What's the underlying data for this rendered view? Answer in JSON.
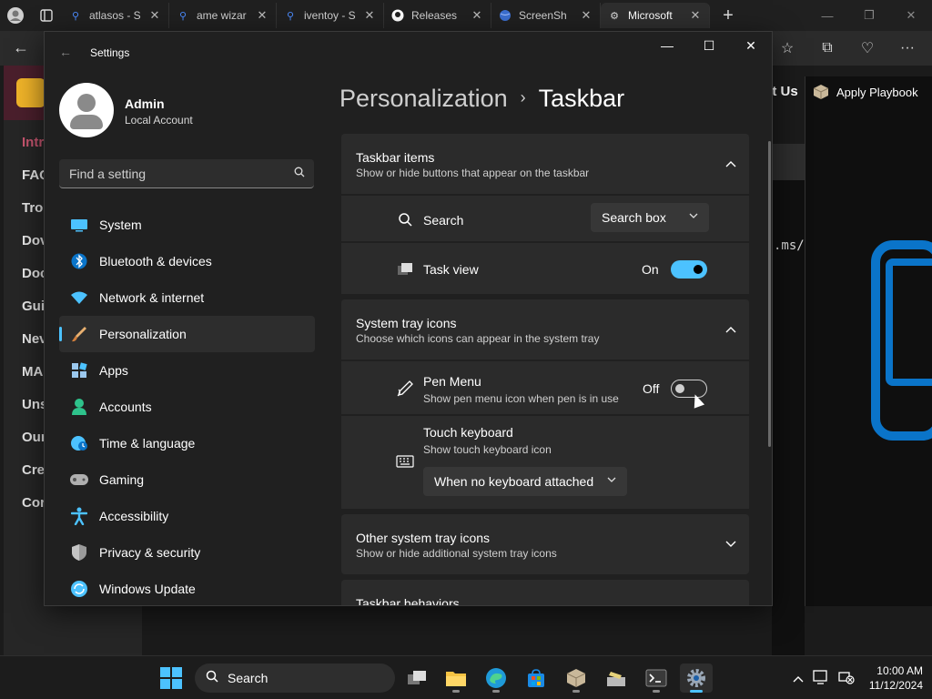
{
  "browser": {
    "tabs": [
      {
        "label": "atlasos - S",
        "icon": "search-icon"
      },
      {
        "label": "ame wizar",
        "icon": "search-icon"
      },
      {
        "label": "iventoy - S",
        "icon": "search-icon"
      },
      {
        "label": "Releases",
        "icon": "github-icon"
      },
      {
        "label": "ScreenSh",
        "icon": "globe-icon"
      },
      {
        "label": "Microsoft",
        "icon": "gear-icon"
      }
    ],
    "new_tab": "+"
  },
  "background_page": {
    "nav_items": [
      "Intro",
      "FAQ",
      "Tro",
      "Dov",
      "Doc",
      "Gui",
      "Nev",
      "MA",
      "Uns",
      "Our",
      "Cre",
      "Cor"
    ],
    "contact": "ct Us",
    "url_fragment": ".ms/",
    "playbook_title": "Apply Playbook"
  },
  "settings": {
    "app_title": "Settings",
    "user": {
      "name": "Admin",
      "account_type": "Local Account"
    },
    "search_placeholder": "Find a setting",
    "nav": [
      {
        "label": "System",
        "icon": "monitor-icon",
        "color": "#4cc2ff"
      },
      {
        "label": "Bluetooth & devices",
        "icon": "bluetooth-icon",
        "color": "#0a74c9"
      },
      {
        "label": "Network & internet",
        "icon": "wifi-icon",
        "color": "#4cc2ff"
      },
      {
        "label": "Personalization",
        "icon": "brush-icon",
        "color": "#e8b070"
      },
      {
        "label": "Apps",
        "icon": "apps-icon",
        "color": "#9bc8ee"
      },
      {
        "label": "Accounts",
        "icon": "accounts-icon",
        "color": "#2ec28b"
      },
      {
        "label": "Time & language",
        "icon": "globe-clock-icon",
        "color": "#4cc2ff"
      },
      {
        "label": "Gaming",
        "icon": "gamepad-icon",
        "color": "#b0b0b0"
      },
      {
        "label": "Accessibility",
        "icon": "accessibility-icon",
        "color": "#4cc2ff"
      },
      {
        "label": "Privacy & security",
        "icon": "shield-icon",
        "color": "#9a9a9a"
      },
      {
        "label": "Windows Update",
        "icon": "update-icon",
        "color": "#4cc2ff"
      }
    ],
    "breadcrumb": {
      "parent": "Personalization",
      "separator": "›",
      "current": "Taskbar"
    },
    "taskbar_items": {
      "title": "Taskbar items",
      "subtitle": "Show or hide buttons that appear on the taskbar",
      "search": {
        "label": "Search",
        "value": "Search box"
      },
      "task_view": {
        "label": "Task view",
        "state": "On"
      }
    },
    "system_tray": {
      "title": "System tray icons",
      "subtitle": "Choose which icons can appear in the system tray",
      "pen_menu": {
        "label": "Pen Menu",
        "desc": "Show pen menu icon when pen is in use",
        "state": "Off"
      },
      "touch_keyboard": {
        "label": "Touch keyboard",
        "desc": "Show touch keyboard icon",
        "value": "When no keyboard attached"
      }
    },
    "other_tray": {
      "title": "Other system tray icons",
      "subtitle": "Show or hide additional system tray icons"
    },
    "behaviors": {
      "title": "Taskbar behaviors"
    }
  },
  "taskbar": {
    "search_label": "Search",
    "time": "10:00 AM",
    "date": "11/12/2024"
  },
  "colors": {
    "accent": "#4cc2ff"
  }
}
